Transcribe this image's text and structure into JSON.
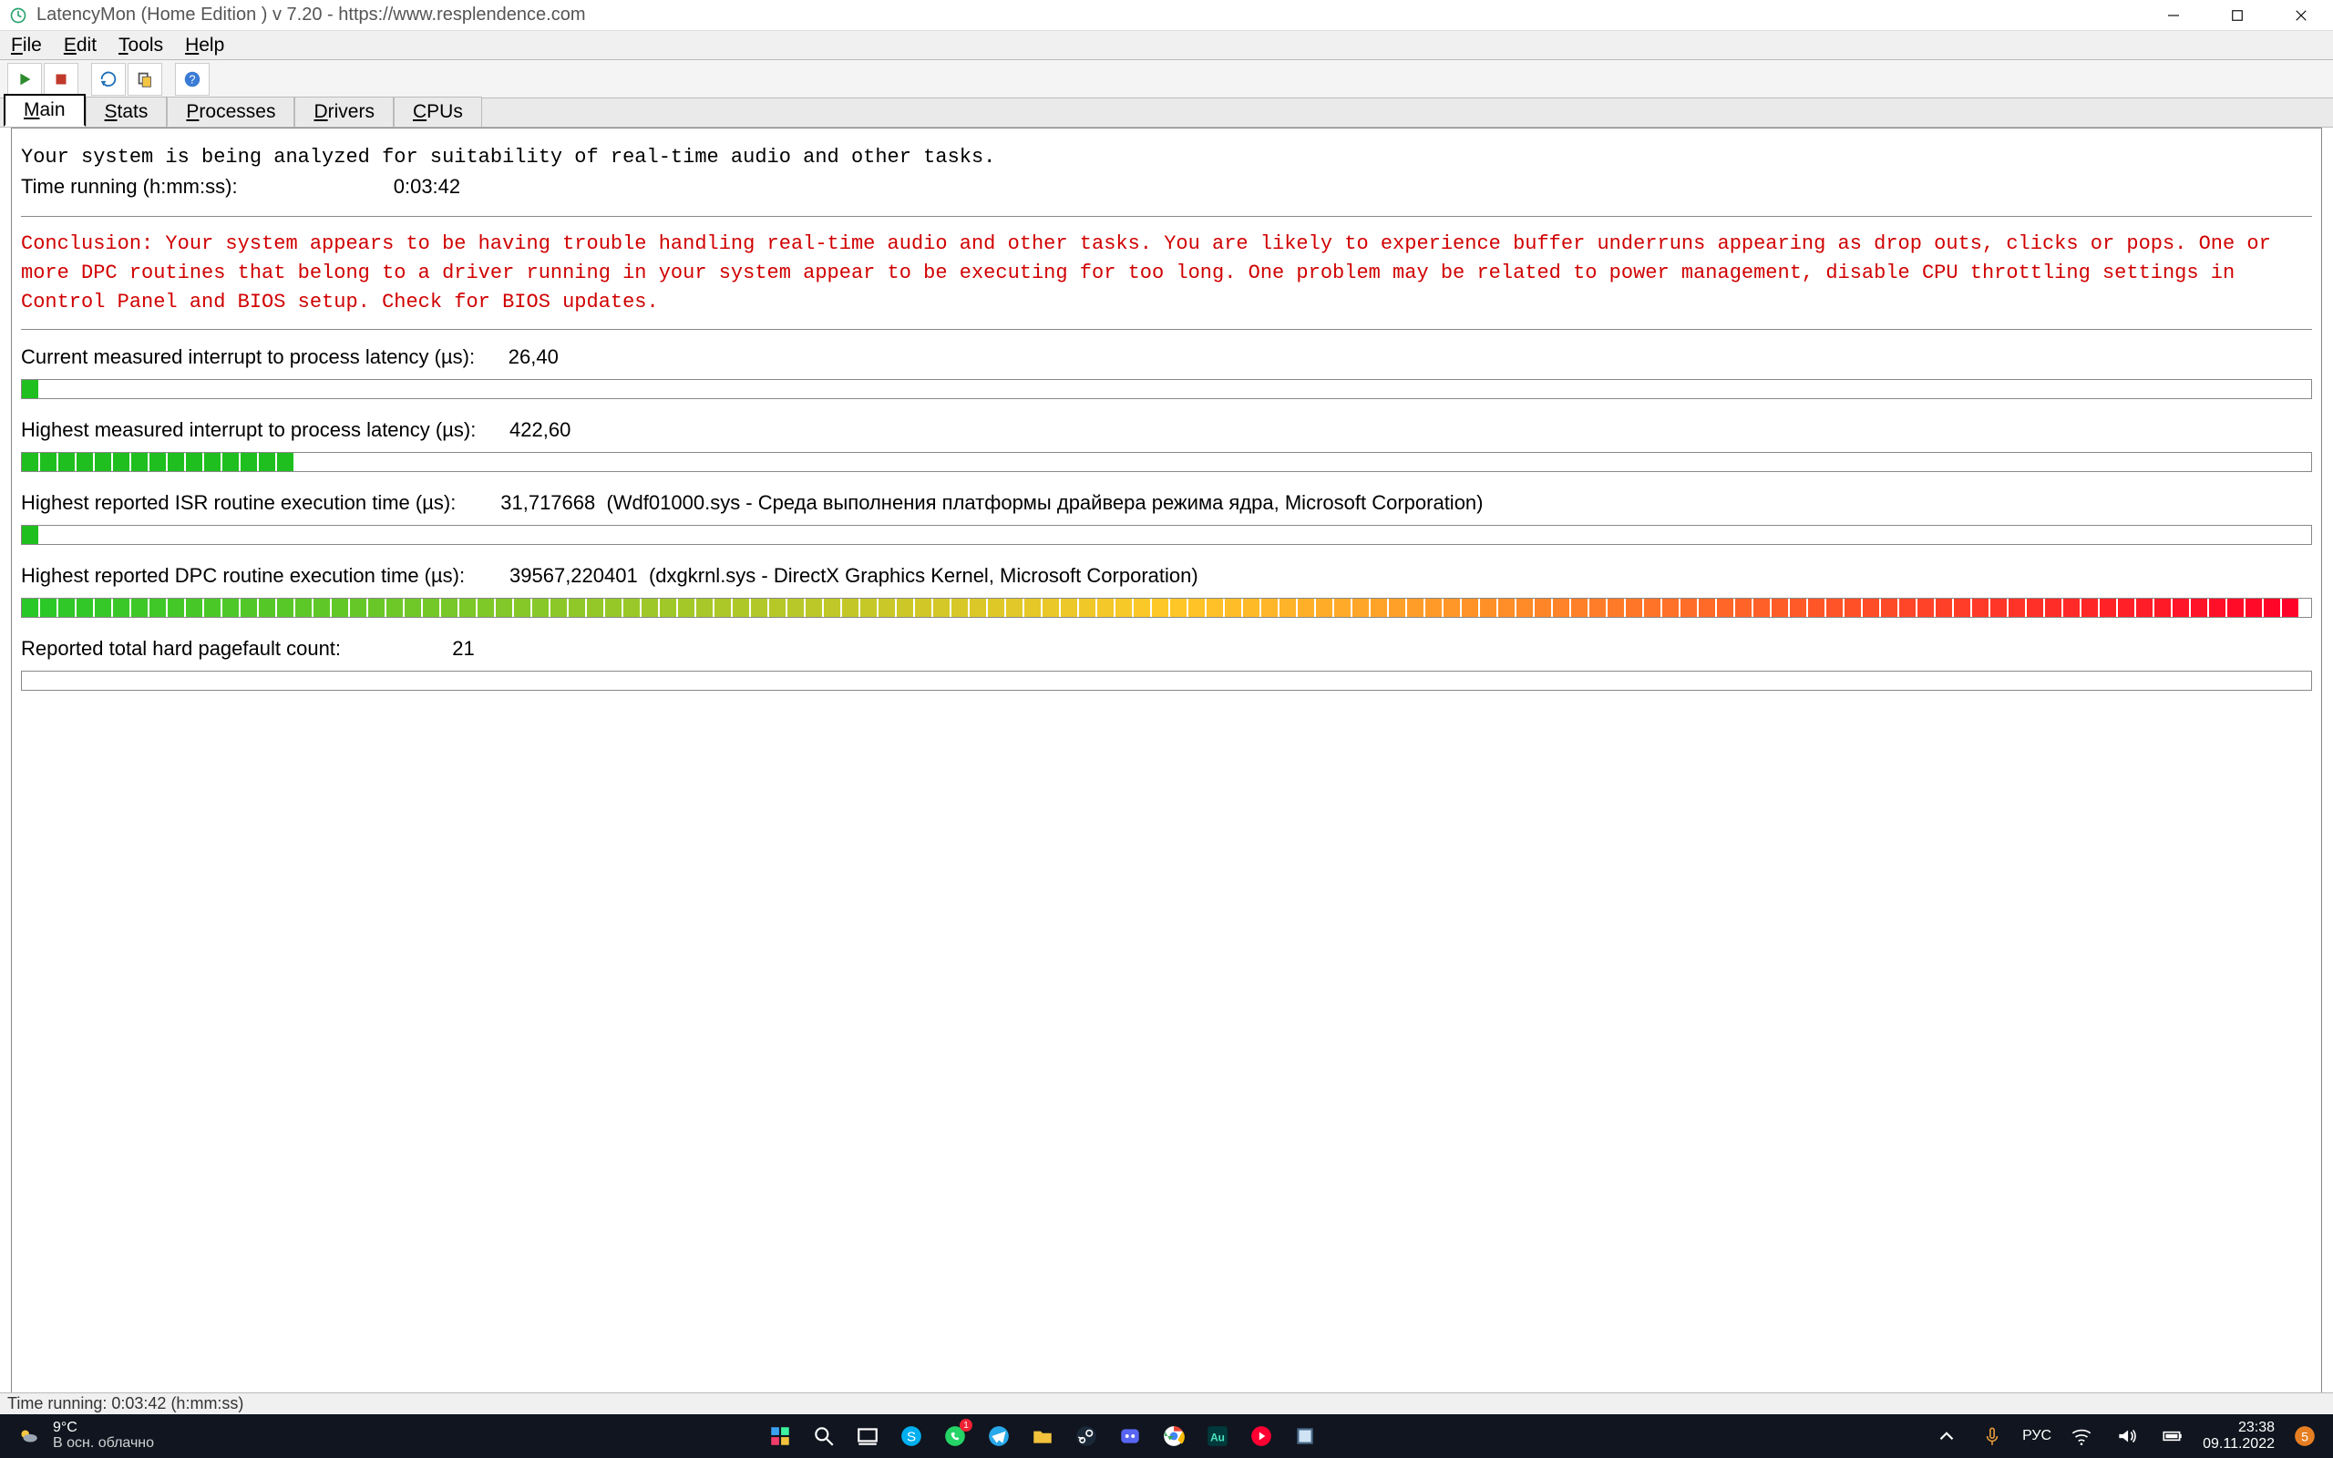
{
  "window": {
    "title": "LatencyMon  (Home Edition )  v 7.20 - https://www.resplendence.com"
  },
  "menu": {
    "file": "File",
    "edit": "Edit",
    "tools": "Tools",
    "help": "Help"
  },
  "tabs": {
    "main": "Main",
    "stats": "Stats",
    "processes": "Processes",
    "drivers": "Drivers",
    "cpus": "CPUs"
  },
  "intro_line": "Your system is being analyzed for suitability of real-time audio and other tasks.",
  "time_label": "Time running (h:mm:ss):",
  "time_value": "0:03:42",
  "conclusion": "Conclusion: Your system appears to be having trouble handling real-time audio and other tasks. You are likely to experience buffer underruns appearing as drop outs, clicks or pops. One or more DPC routines that belong to a driver running in your system appear to be executing for too long. One problem may be related to power management, disable CPU throttling settings in Control Panel and BIOS setup. Check for BIOS updates.",
  "metrics": {
    "current_label": "Current measured interrupt to process latency (µs):",
    "current_value": "26,40",
    "highest_label": "Highest measured interrupt to process latency (µs):",
    "highest_value": "422,60",
    "isr_label": "Highest reported ISR routine execution time (µs):",
    "isr_value": "31,717668  (Wdf01000.sys - Среда выполнения платформы драйвера режима ядра, Microsoft Corporation)",
    "dpc_label": "Highest reported DPC routine execution time (µs):",
    "dpc_value": "39567,220401  (dxgkrnl.sys - DirectX Graphics Kernel, Microsoft Corporation)",
    "pf_label": "Reported total hard pagefault count:",
    "pf_value": "21"
  },
  "bars": {
    "current_pct": 1.0,
    "highest_pct": 12.5,
    "isr_pct": 1.0,
    "dpc_pct": 100.0
  },
  "statusbar": "Time running: 0:03:42  (h:mm:ss)",
  "taskbar": {
    "weather_temp": "9°C",
    "weather_desc": "В осн. облачно",
    "lang": "РУС",
    "time": "23:38",
    "date": "09.11.2022"
  }
}
